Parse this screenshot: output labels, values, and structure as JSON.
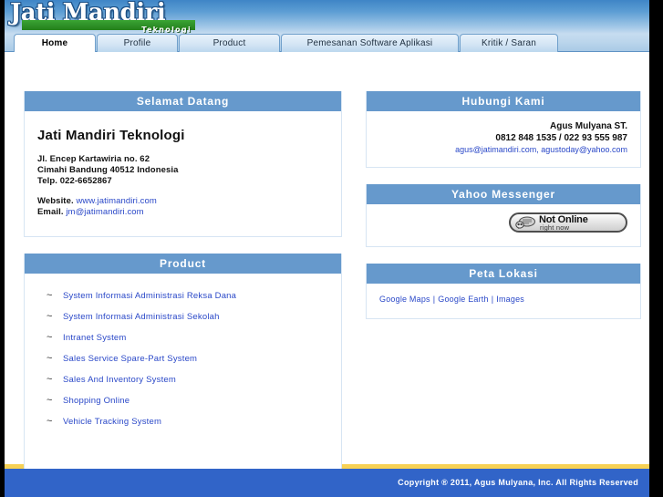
{
  "site": {
    "logo_name": "Jati Mandiri",
    "logo_sub": "Teknologi"
  },
  "nav": {
    "tabs": [
      {
        "label": "Home",
        "active": true
      },
      {
        "label": "Profile",
        "active": false
      },
      {
        "label": "Product",
        "active": false
      },
      {
        "label": "Pemesanan Software Aplikasi",
        "active": false
      },
      {
        "label": "Kritik / Saran",
        "active": false
      }
    ]
  },
  "welcome": {
    "title": "Selamat Datang",
    "company": "Jati Mandiri Teknologi",
    "address1": "Jl. Encep Kartawiria no. 62",
    "address2": "Cimahi Bandung 40512 Indonesia",
    "phone": "Telp. 022-6652867",
    "website_label": "Website.",
    "website_value": "www.jatimandiri.com",
    "email_label": "Email.",
    "email_value": "jm@jatimandiri.com"
  },
  "product": {
    "title": "Product",
    "bullet": "~",
    "items": [
      "System Informasi Administrasi Reksa Dana",
      "System Informasi Administrasi Sekolah",
      "Intranet System",
      "Sales Service Spare-Part System",
      "Sales And Inventory System",
      "Shopping Online",
      "Vehicle Tracking System"
    ]
  },
  "contact": {
    "title": "Hubungi Kami",
    "name": "Agus Mulyana ST.",
    "phones": "0812 848 1535 / 022 93 555 987",
    "email1": "agus@jatimandiri.com",
    "email_sep": ", ",
    "email2": "agustoday@yahoo.com"
  },
  "messenger": {
    "title": "Yahoo Messenger",
    "status_main": "Not Online",
    "status_sub": "right now"
  },
  "map": {
    "title": "Peta Lokasi",
    "links": [
      "Google Maps",
      "Google Earth",
      "Images"
    ],
    "separator": "|"
  },
  "footer": {
    "copyright": "Copyright ® 2011, Agus Mulyana, Inc. All Rights Reserved"
  },
  "colors": {
    "panel_header": "#6699cc",
    "link": "#2a48c8",
    "footer_bar": "#3164c8",
    "footer_strip": "#f7d154",
    "logo_green": "#2f9129"
  }
}
